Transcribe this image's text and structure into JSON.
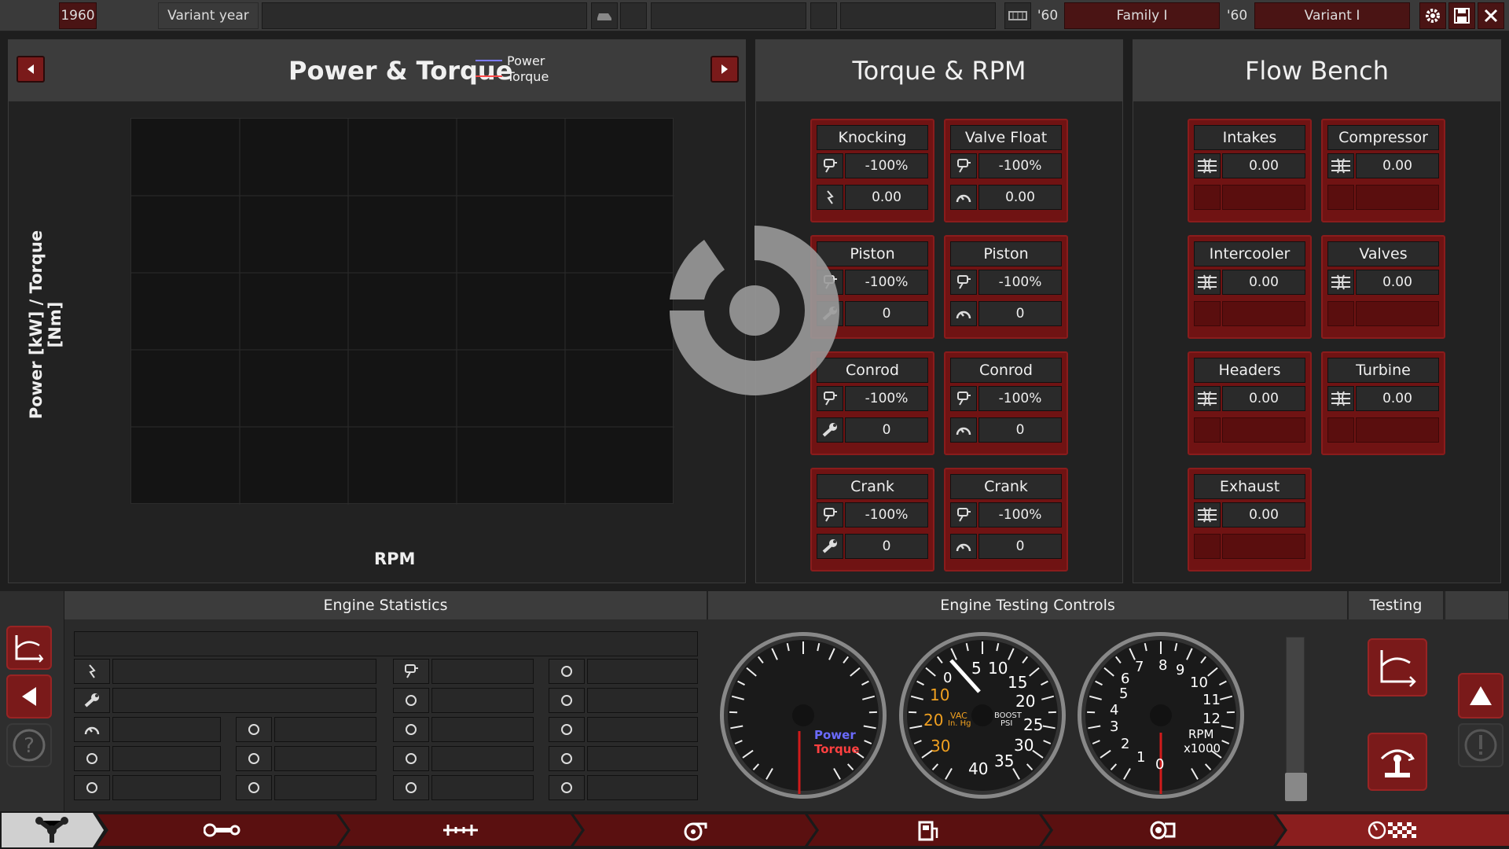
{
  "topbar": {
    "year": "1960",
    "variant_year_label": "Variant year",
    "family_year": "'60",
    "family_name": "Family I",
    "variant_year": "'60",
    "variant_name": "Variant I",
    "icons": [
      "car-icon",
      "blank-slot",
      "blank-slot",
      "engine-block-icon",
      "gear-icon",
      "save-icon",
      "close-icon"
    ]
  },
  "power_panel": {
    "title": "Power & Torque",
    "legend": [
      {
        "name": "Power",
        "color": "#7a7aff"
      },
      {
        "name": "Torque",
        "color": "#ff4a4a"
      }
    ],
    "ylabel": "Power [kW] / Torque [Nm]",
    "xlabel": "RPM"
  },
  "chart_data": {
    "type": "line",
    "title": "Power & Torque",
    "xlabel": "RPM",
    "ylabel": "Power [kW] / Torque [Nm]",
    "series": [
      {
        "name": "Power",
        "values": []
      },
      {
        "name": "Torque",
        "values": []
      }
    ],
    "grid": true,
    "legend_position": "top"
  },
  "torque_panel": {
    "title": "Torque & RPM",
    "cards": [
      {
        "title": "Knocking",
        "v1": "-100%",
        "v2": "0.00",
        "icon1": "piston-icon",
        "icon2": "spark-icon"
      },
      {
        "title": "Valve Float",
        "v1": "-100%",
        "v2": "0.00",
        "icon1": "piston-icon",
        "icon2": "gauge-icon"
      },
      {
        "title": "Piston",
        "v1": "-100%",
        "v2": "0",
        "icon1": "piston-icon",
        "icon2": "wrench-icon"
      },
      {
        "title": "Piston",
        "v1": "-100%",
        "v2": "0",
        "icon1": "piston-icon",
        "icon2": "gauge-icon"
      },
      {
        "title": "Conrod",
        "v1": "-100%",
        "v2": "0",
        "icon1": "piston-icon",
        "icon2": "wrench-icon"
      },
      {
        "title": "Conrod",
        "v1": "-100%",
        "v2": "0",
        "icon1": "piston-icon",
        "icon2": "gauge-icon"
      },
      {
        "title": "Crank",
        "v1": "-100%",
        "v2": "0",
        "icon1": "piston-icon",
        "icon2": "wrench-icon"
      },
      {
        "title": "Crank",
        "v1": "-100%",
        "v2": "0",
        "icon1": "piston-icon",
        "icon2": "gauge-icon"
      }
    ]
  },
  "flow_panel": {
    "title": "Flow Bench",
    "cards": [
      {
        "title": "Intakes",
        "v1": "0.00"
      },
      {
        "title": "Compressor",
        "v1": "0.00"
      },
      {
        "title": "Intercooler",
        "v1": "0.00"
      },
      {
        "title": "Valves",
        "v1": "0.00"
      },
      {
        "title": "Headers",
        "v1": "0.00"
      },
      {
        "title": "Turbine",
        "v1": "0.00"
      },
      {
        "title": "Exhaust",
        "v1": "0.00"
      }
    ]
  },
  "stats": {
    "title": "Engine Statistics",
    "icons": [
      "spark-icon",
      "wrench-icon",
      "gauge-icon",
      "rpm-gauge-icon",
      "snowflake-icon",
      "radiator-icon",
      "turbo-icon",
      "speaker-icon",
      "piston-icon",
      "engine-icon",
      "fuel-can-icon",
      "fuel-pump-icon",
      "intake-icon",
      "weight-icon",
      "move-arrows-icon",
      "person-icon",
      "anvil-icon",
      "tools-icon"
    ]
  },
  "testing_controls": {
    "title": "Engine Testing Controls",
    "gauge1": {
      "labels": [
        "Power",
        "Torque"
      ]
    },
    "gauge2": {
      "ticks": [
        "5",
        "10",
        "15",
        "20",
        "25",
        "30",
        "35",
        "40"
      ],
      "vac_ticks": [
        "10",
        "20",
        "30"
      ],
      "vac_label": "VAC",
      "vac_unit": "In. Hg",
      "boost_label": "BOOST",
      "boost_unit": "PSI",
      "zero": "0"
    },
    "gauge3": {
      "ticks": [
        "0",
        "1",
        "2",
        "3",
        "4",
        "5",
        "6",
        "7",
        "8",
        "9",
        "10",
        "11",
        "12"
      ],
      "label": "RPM",
      "unit": "x1000"
    }
  },
  "testing": {
    "title": "Testing"
  },
  "tabs": [
    "engine-parts-icon",
    "conrod-icon",
    "crankshaft-icon",
    "turbo-icon",
    "fuel-icon",
    "exhaust-icon",
    "testing-flag-icon"
  ]
}
